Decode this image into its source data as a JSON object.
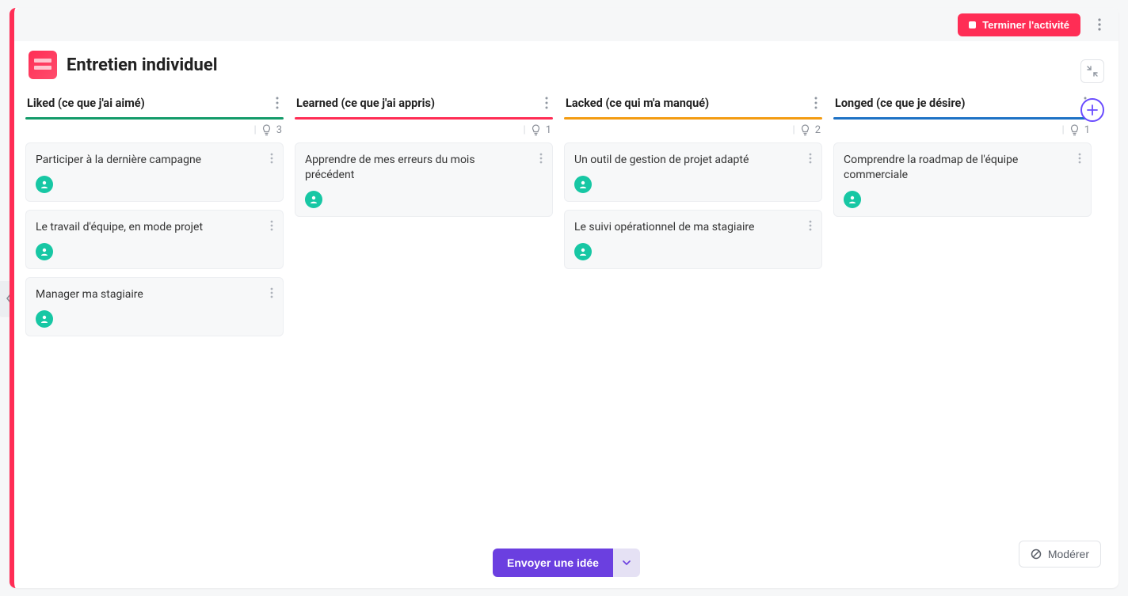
{
  "header": {
    "finish_label": "Terminer l'activité"
  },
  "title": "Entretien individuel",
  "columns": [
    {
      "title": "Liked (ce que j'ai aimé)",
      "accent": "#149b6a",
      "count": 3,
      "cards": [
        {
          "text": "Participer à la dernière campagne"
        },
        {
          "text": "Le travail d'équipe, en mode projet"
        },
        {
          "text": "Manager ma stagiaire"
        }
      ]
    },
    {
      "title": "Learned (ce que j'ai appris)",
      "accent": "#ff2d55",
      "count": 1,
      "cards": [
        {
          "text": "Apprendre de mes erreurs du mois précédent"
        }
      ]
    },
    {
      "title": "Lacked (ce qui m'a manqué)",
      "accent": "#f39c12",
      "count": 2,
      "cards": [
        {
          "text": "Un outil de gestion de projet adapté"
        },
        {
          "text": "Le suivi opérationnel de ma stagiaire"
        }
      ]
    },
    {
      "title": "Longed (ce que je désire)",
      "accent": "#1e72c5",
      "count": 1,
      "cards": [
        {
          "text": "Comprendre la roadmap de l'équipe commerciale"
        }
      ]
    }
  ],
  "footer": {
    "send_label": "Envoyer une idée",
    "moderate_label": "Modérer"
  }
}
